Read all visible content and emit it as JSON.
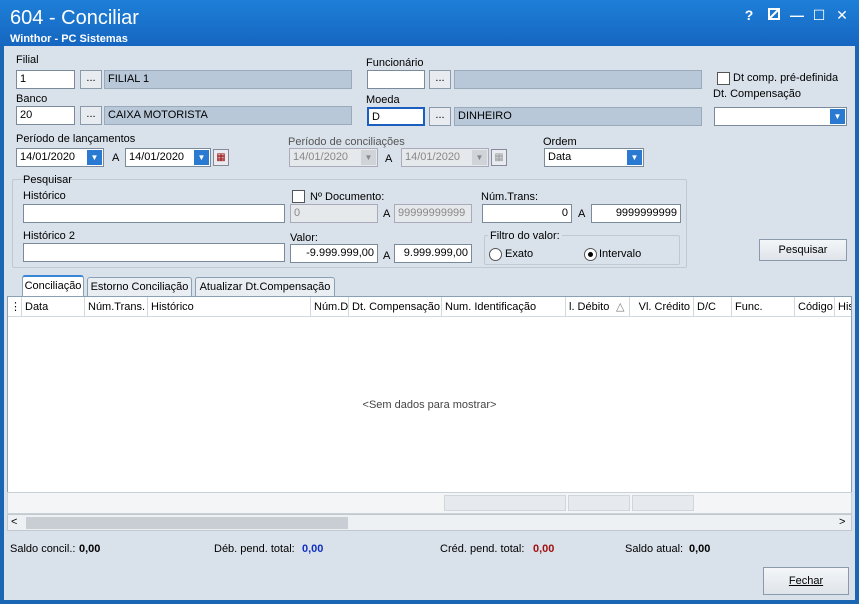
{
  "window": {
    "title": "604 - Conciliar",
    "subtitle": "Winthor - PC Sistemas",
    "help": "?",
    "minimize": "—",
    "maximize": "☐",
    "close": "✕"
  },
  "filial": {
    "label": "Filial",
    "code": "1",
    "name": "FILIAL 1",
    "lookup": "..."
  },
  "funcionario": {
    "label": "Funcionário",
    "code": "",
    "name": "",
    "lookup": "..."
  },
  "banco": {
    "label": "Banco",
    "code": "20",
    "name": "CAIXA MOTORISTA",
    "lookup": "..."
  },
  "moeda": {
    "label": "Moeda",
    "code": "D",
    "name": "DINHEIRO",
    "lookup": "..."
  },
  "dt_comp": {
    "checkbox_label": "Dt comp. pré-definida",
    "label": "Dt. Compensação",
    "value": ""
  },
  "periodo_lanc": {
    "label": "Período de lançamentos",
    "from": "14/01/2020",
    "sep": "A",
    "to": "14/01/2020"
  },
  "periodo_conc": {
    "label": "Período de conciliações",
    "from": "14/01/2020",
    "sep": "A",
    "to": "14/01/2020"
  },
  "ordem": {
    "label": "Ordem",
    "value": "Data"
  },
  "pesquisar": {
    "group_label": "Pesquisar",
    "historico_label": "Histórico",
    "historico_value": "",
    "historico2_label": "Histórico 2",
    "historico2_value": "",
    "ndoc_label": "Nº Documento:",
    "ndoc_from": "0",
    "ndoc_sep": "A",
    "ndoc_to": "99999999999",
    "numtrans_label": "Núm.Trans:",
    "numtrans_from": "0",
    "numtrans_sep": "A",
    "numtrans_to": "9999999999",
    "valor_label": "Valor:",
    "valor_from": "-9.999.999,00",
    "valor_sep": "A",
    "valor_to": "9.999.999,00",
    "filtro_label": "Filtro do valor:",
    "exato_label": "Exato",
    "intervalo_label": "Intervalo"
  },
  "search_button": "Pesquisar",
  "tabs": [
    "Conciliação",
    "Estorno Conciliação",
    "Atualizar Dt.Compensação"
  ],
  "grid": {
    "columns": [
      "Data",
      "Núm.Trans.",
      "Histórico",
      "Núm.Do",
      "Dt. Compensação",
      "Num. Identificação",
      "l. Débito",
      "Vl. Crédito",
      "D/C",
      "Func.",
      "Código",
      "His"
    ],
    "empty_message": "<Sem dados para mostrar>"
  },
  "totals": {
    "saldo_concil_label": "Saldo concil.:",
    "saldo_concil_value": "0,00",
    "deb_label": "Déb. pend. total:",
    "deb_value": "0,00",
    "cred_label": "Créd. pend. total:",
    "cred_value": "0,00",
    "saldo_atual_label": "Saldo atual:",
    "saldo_atual_value": "0,00"
  },
  "close_button": "Fechar",
  "colors": {
    "titlebar": "#1e7fd8",
    "deb_value": "#1030c0",
    "cred_value": "#a01010"
  }
}
